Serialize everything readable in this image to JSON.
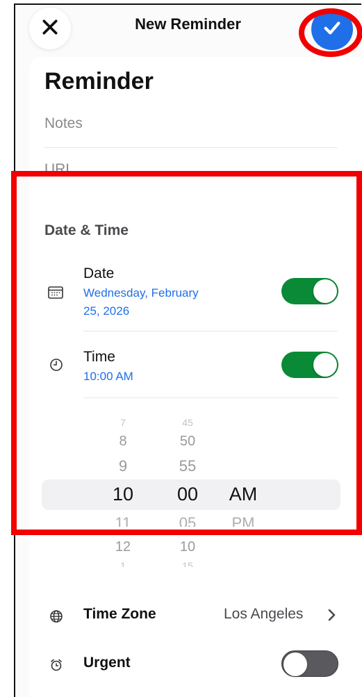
{
  "nav": {
    "title": "New Reminder",
    "close_icon": "close-icon",
    "done_icon": "checkmark-icon"
  },
  "form": {
    "title": "Reminder",
    "notes_placeholder": "Notes",
    "url_placeholder": "URL"
  },
  "date_time": {
    "section_title": "Date & Time",
    "date": {
      "label": "Date",
      "value_line1": "Wednesday, February",
      "value_line2": "25, 2026",
      "enabled": true,
      "icon": "calendar-icon"
    },
    "time": {
      "label": "Time",
      "value": "10:00 AM",
      "enabled": true,
      "icon": "clock-icon"
    }
  },
  "time_picker": {
    "hours": [
      "7",
      "8",
      "9",
      "10",
      "11",
      "12",
      "1"
    ],
    "minutes": [
      "45",
      "50",
      "55",
      "00",
      "05",
      "10",
      "15"
    ],
    "periods": [
      "AM",
      "PM"
    ],
    "selected_hour": "10",
    "selected_minute": "00",
    "selected_period": "AM"
  },
  "time_zone": {
    "label": "Time Zone",
    "value": "Los Angeles",
    "icon": "globe-icon"
  },
  "urgent": {
    "label": "Urgent",
    "enabled": false,
    "icon": "alarm-icon"
  },
  "colors": {
    "accent": "#1f6fe8",
    "toggle_on": "#0a8a36",
    "toggle_off": "#5a5a5e",
    "annotation": "#f20000"
  }
}
